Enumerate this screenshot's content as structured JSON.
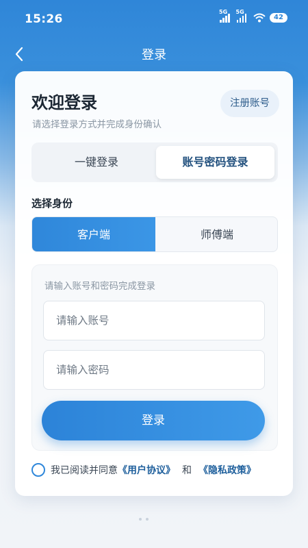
{
  "status": {
    "time": "15:26",
    "signal1_tag": "5G",
    "signal2_tag": "5G",
    "battery": "42",
    "icons": [
      "signal-icon",
      "signal-icon",
      "wifi-icon",
      "battery-icon"
    ]
  },
  "nav": {
    "back_icon": "chevron-left-icon",
    "title": "登录"
  },
  "card": {
    "title": "欢迎登录",
    "subtitle": "请选择登录方式并完成身份确认",
    "register_label": "注册账号"
  },
  "login_tabs": [
    {
      "label": "一键登录",
      "active": false
    },
    {
      "label": "账号密码登录",
      "active": true
    }
  ],
  "role": {
    "label": "选择身份",
    "options": [
      {
        "label": "客户端",
        "selected": true
      },
      {
        "label": "师傅端",
        "selected": false
      }
    ]
  },
  "form": {
    "hint": "请输入账号和密码完成登录",
    "account_placeholder": "请输入账号",
    "password_placeholder": "请输入密码",
    "submit_label": "登录"
  },
  "agreement": {
    "prefix": "我已阅读并同意",
    "user_agreement": "《用户协议》",
    "and": "和",
    "privacy_policy": "《隐私政策》",
    "checked": false
  },
  "colors": {
    "primary": "#2f87da",
    "link": "#1e5f9c",
    "header_bg": "#2f86d8"
  }
}
